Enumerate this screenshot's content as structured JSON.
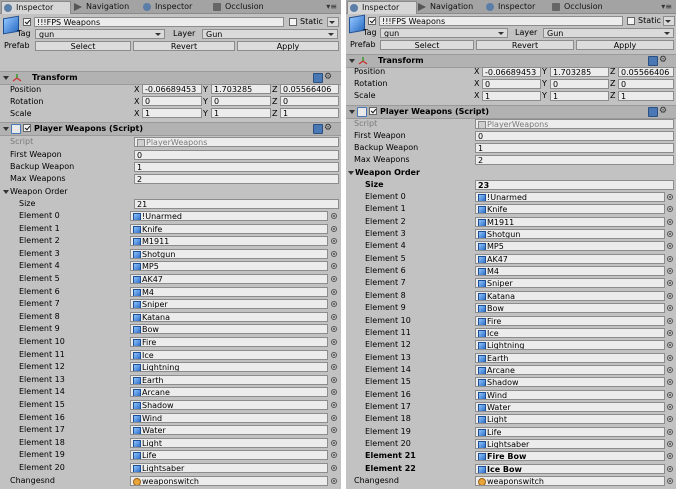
{
  "tabs": {
    "inspector": "Inspector",
    "navigation": "Navigation",
    "occlusion": "Occlusion"
  },
  "object": {
    "name": "!!!FPS Weapons",
    "static_label": "Static",
    "tag_label": "Tag",
    "tag_value": "gun",
    "layer_label": "Layer",
    "layer_value": "Gun",
    "prefab_label": "Prefab",
    "prefab_select": "Select",
    "prefab_revert": "Revert",
    "prefab_apply": "Apply"
  },
  "transform": {
    "title": "Transform",
    "position_label": "Position",
    "rotation_label": "Rotation",
    "scale_label": "Scale",
    "axis_x": "X",
    "axis_y": "Y",
    "axis_z": "Z",
    "position": [
      "-0.06689453",
      "1.703285",
      "0.05566406"
    ],
    "rotation": [
      "0",
      "0",
      "0"
    ],
    "scale": [
      "1",
      "1",
      "1"
    ]
  },
  "component": {
    "title": "Player Weapons (Script)",
    "script_label": "Script",
    "script_value": "PlayerWeapons",
    "first_weapon_label": "First Weapon",
    "first_weapon_value": "0",
    "backup_weapon_label": "Backup Weapon",
    "backup_weapon_value": "1",
    "max_weapons_label": "Max Weapons",
    "max_weapons_value": "2",
    "weapon_order_label": "Weapon Order",
    "size_label": "Size",
    "changesnd_label": "Changesnd",
    "changesnd_value": "weaponswitch"
  },
  "left": {
    "size_value": "21",
    "elements": [
      {
        "label": "Element 0",
        "value": "!Unarmed"
      },
      {
        "label": "Element 1",
        "value": "Knife"
      },
      {
        "label": "Element 2",
        "value": "M1911"
      },
      {
        "label": "Element 3",
        "value": "Shotgun"
      },
      {
        "label": "Element 4",
        "value": "MP5"
      },
      {
        "label": "Element 5",
        "value": "AK47"
      },
      {
        "label": "Element 6",
        "value": "M4"
      },
      {
        "label": "Element 7",
        "value": "Sniper"
      },
      {
        "label": "Element 8",
        "value": "Katana"
      },
      {
        "label": "Element 9",
        "value": "Bow"
      },
      {
        "label": "Element 10",
        "value": "Fire"
      },
      {
        "label": "Element 11",
        "value": "Ice"
      },
      {
        "label": "Element 12",
        "value": "Lightning"
      },
      {
        "label": "Element 13",
        "value": "Earth"
      },
      {
        "label": "Element 14",
        "value": "Arcane"
      },
      {
        "label": "Element 15",
        "value": "Shadow"
      },
      {
        "label": "Element 16",
        "value": "Wind"
      },
      {
        "label": "Element 17",
        "value": "Water"
      },
      {
        "label": "Element 18",
        "value": "Light"
      },
      {
        "label": "Element 19",
        "value": "Life"
      },
      {
        "label": "Element 20",
        "value": "Lightsaber"
      }
    ]
  },
  "right": {
    "size_value": "23",
    "elements": [
      {
        "label": "Element 0",
        "value": "!Unarmed"
      },
      {
        "label": "Element 1",
        "value": "Knife"
      },
      {
        "label": "Element 2",
        "value": "M1911"
      },
      {
        "label": "Element 3",
        "value": "Shotgun"
      },
      {
        "label": "Element 4",
        "value": "MP5"
      },
      {
        "label": "Element 5",
        "value": "AK47"
      },
      {
        "label": "Element 6",
        "value": "M4"
      },
      {
        "label": "Element 7",
        "value": "Sniper"
      },
      {
        "label": "Element 8",
        "value": "Katana"
      },
      {
        "label": "Element 9",
        "value": "Bow"
      },
      {
        "label": "Element 10",
        "value": "Fire"
      },
      {
        "label": "Element 11",
        "value": "Ice"
      },
      {
        "label": "Element 12",
        "value": "Lightning"
      },
      {
        "label": "Element 13",
        "value": "Earth"
      },
      {
        "label": "Element 14",
        "value": "Arcane"
      },
      {
        "label": "Element 15",
        "value": "Shadow"
      },
      {
        "label": "Element 16",
        "value": "Wind"
      },
      {
        "label": "Element 17",
        "value": "Water"
      },
      {
        "label": "Element 18",
        "value": "Light"
      },
      {
        "label": "Element 19",
        "value": "Life"
      },
      {
        "label": "Element 20",
        "value": "Lightsaber"
      },
      {
        "label": "Element 21",
        "value": "Fire Bow"
      },
      {
        "label": "Element 22",
        "value": "Ice Bow"
      }
    ]
  },
  "colors": {
    "panel_bg": "#c2c2c2",
    "tab_bar_bg": "#a3a3a3",
    "field_bg": "#ececec",
    "accent_blue": "#4a78b5"
  },
  "icons": {
    "tab_inspector": "inspector-icon",
    "tab_navigation": "navigation-icon",
    "tab_occlusion": "occlusion-icon",
    "object": "gameobject-cube-icon",
    "transform": "transform-axes-icon",
    "component": "script-component-icon",
    "help": "help-book-icon",
    "settings": "gear-icon",
    "prefab_ref": "prefab-icon",
    "audio_ref": "audio-clip-icon",
    "object_picker": "object-picker-target-icon"
  }
}
